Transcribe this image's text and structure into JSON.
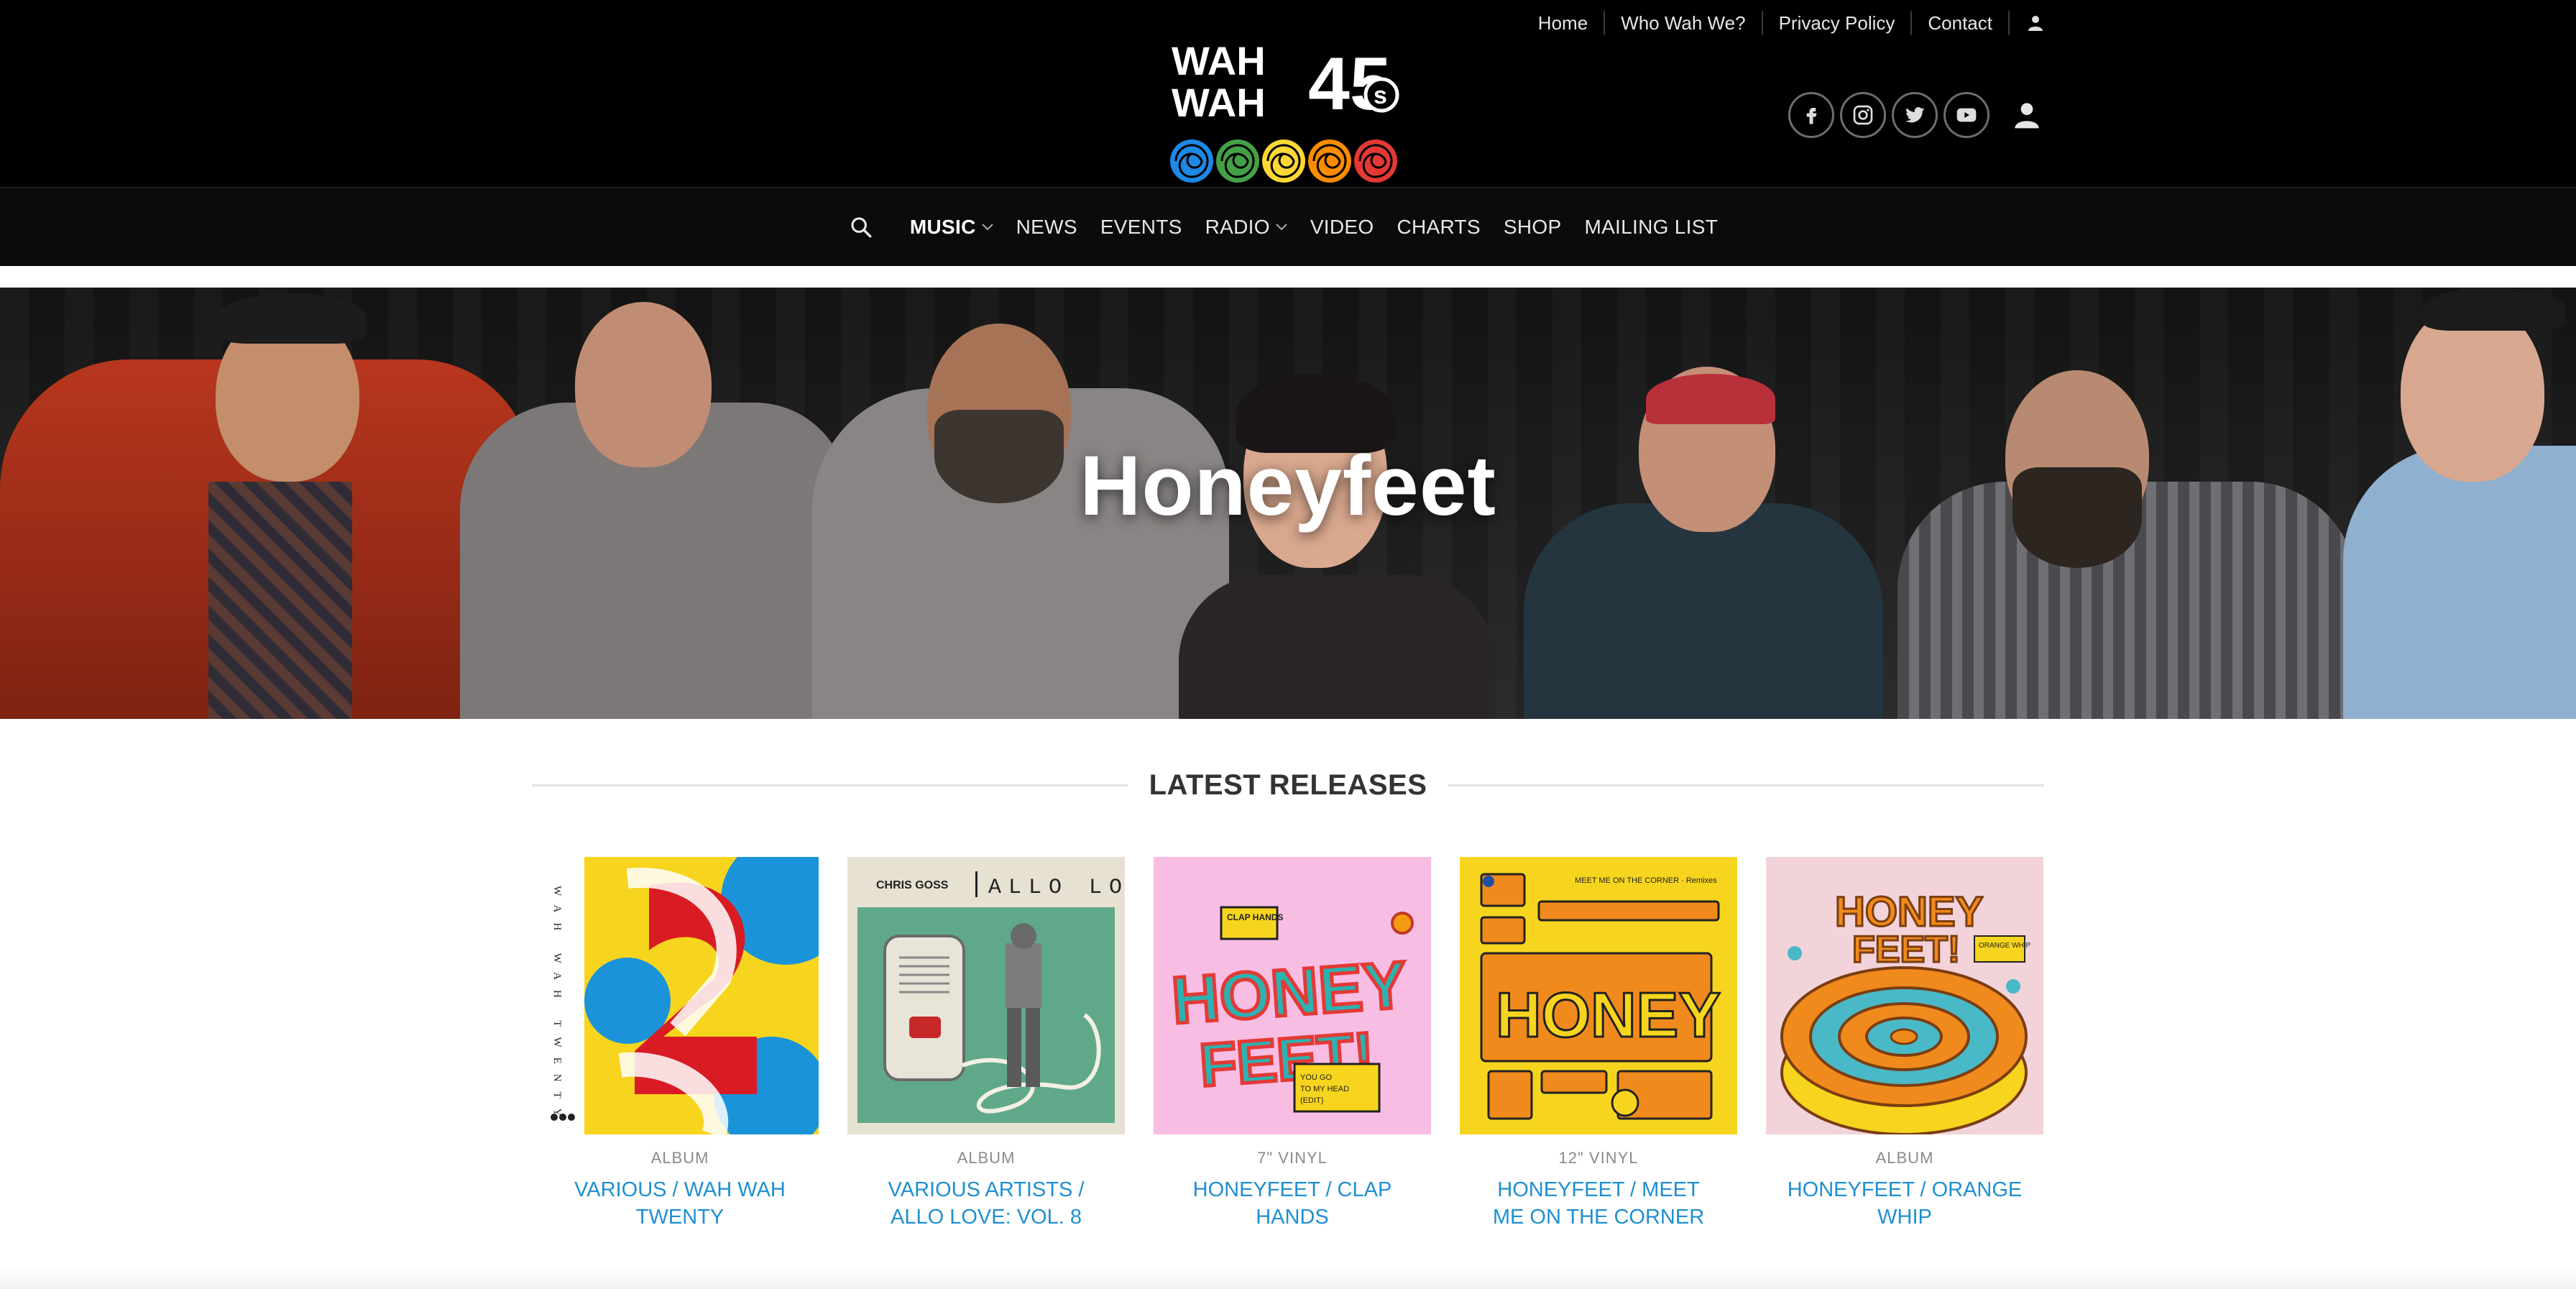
{
  "top_links": [
    "Home",
    "Who Wah We?",
    "Privacy Policy",
    "Contact"
  ],
  "logo": {
    "line1": "WAH",
    "line2": "WAH",
    "number": "45",
    "suffix": "s",
    "colors": [
      "#1e88e5",
      "#43a047",
      "#fdd835",
      "#fb8c00",
      "#e53935"
    ]
  },
  "socials": [
    "facebook-icon",
    "instagram-icon",
    "twitter-icon",
    "youtube-icon"
  ],
  "main_nav": [
    {
      "label": "Music",
      "dropdown": true,
      "active": true
    },
    {
      "label": "News",
      "dropdown": false
    },
    {
      "label": "Events",
      "dropdown": false
    },
    {
      "label": "Radio",
      "dropdown": true
    },
    {
      "label": "Video",
      "dropdown": false
    },
    {
      "label": "Charts",
      "dropdown": false
    },
    {
      "label": "Shop",
      "dropdown": false
    },
    {
      "label": "Mailing List",
      "dropdown": false
    }
  ],
  "hero": {
    "title": "Honeyfeet"
  },
  "releases_heading": "LATEST RELEASES",
  "releases": [
    {
      "type": "ALBUM",
      "title": "VARIOUS / WAH WAH TWENTY"
    },
    {
      "type": "ALBUM",
      "title": "VARIOUS ARTISTS / ALLO LOVE: VOL. 8"
    },
    {
      "type": "7\" VINYL",
      "title": "HONEYFEET / CLAP HANDS"
    },
    {
      "type": "12\" VINYL",
      "title": "HONEYFEET / MEET ME ON THE CORNER"
    },
    {
      "type": "ALBUM",
      "title": "HONEYFEET / ORANGE WHIP"
    }
  ],
  "cover_text": {
    "allo_love": "ALLO LOVE",
    "chris_goss": "CHRIS GOSS",
    "clap_hands": "CLAP HANDS",
    "you_go": "YOU GO TO MY HEAD (EDIT)",
    "meet_me": "MEET ME ON THE CORNER · Remixes",
    "orange_whip": "ORANGE WHIP",
    "honeyfeet": "HONEY FEET",
    "wah_wah_twenty": "WAH WAH TWENTY"
  }
}
